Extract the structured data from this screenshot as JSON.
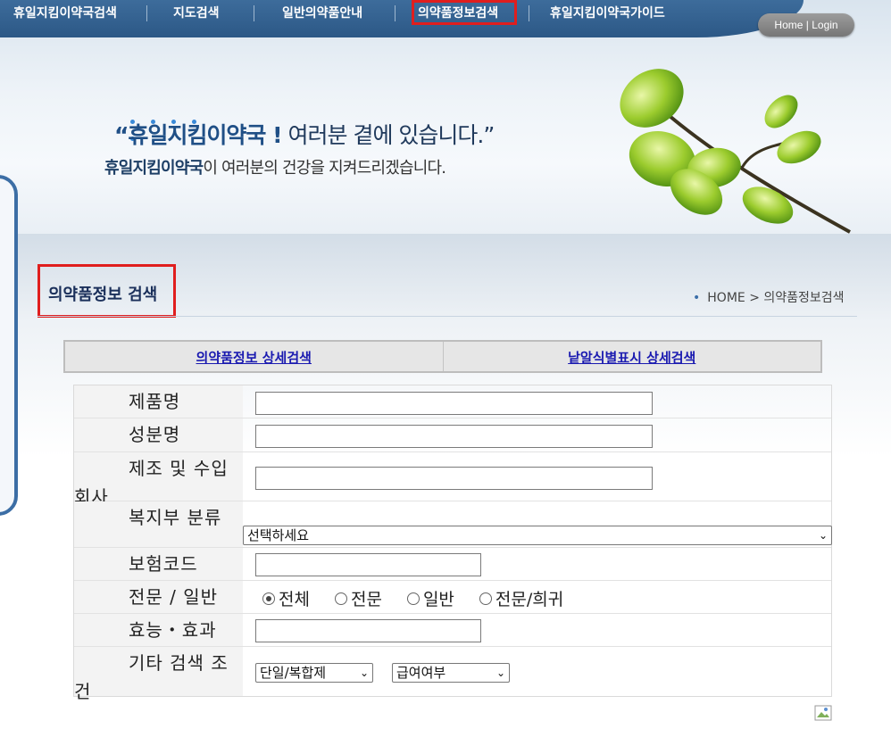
{
  "nav": {
    "items": [
      {
        "label": "휴일지킴이약국검색"
      },
      {
        "label": "지도검색"
      },
      {
        "label": "일반의약품안내"
      },
      {
        "label": "의약품정보검색"
      },
      {
        "label": "휴일지킴이약국가이드"
      }
    ],
    "active_index": 3,
    "home_label": "Home",
    "login_label": "Login"
  },
  "banner": {
    "line1_strong": "“휴일지킴이약국 !",
    "line1_rest": " 여러분 곁에 있습니다.”",
    "line2_strong": "휴일지킴이약국",
    "line2_rest": "이 여러분의 건강을 지켜드리겠습니다."
  },
  "page": {
    "title": "의약품정보 검색",
    "breadcrumb_home": "HOME",
    "breadcrumb_sep": ">",
    "breadcrumb_current": "의약품정보검색"
  },
  "tabs": [
    {
      "label": "의약품정보 상세검색"
    },
    {
      "label": "낱알식별표시 상세검색"
    }
  ],
  "form": {
    "product_name_label": "제품명",
    "ingredient_label": "성분명",
    "company_label_1": "제조 및 수입",
    "company_label_2": "회사",
    "category_label": "복지부 분류",
    "category_selected": "선택하세요",
    "insurance_label": "보험코드",
    "type_label": "전문 / 일반",
    "type_options": [
      "전체",
      "전문",
      "일반",
      "전문/희귀"
    ],
    "type_selected": 0,
    "efficacy_label": "효능・효과",
    "other_label_1": "기타 검색 조",
    "other_label_2": "건",
    "compound_selected": "단일/복합제",
    "coverage_selected": "급여여부"
  },
  "colors": {
    "nav_bg": "#2c5886",
    "highlight": "#e01e1e",
    "tab_link": "#1a1ab0",
    "title": "#1a2f5a"
  }
}
